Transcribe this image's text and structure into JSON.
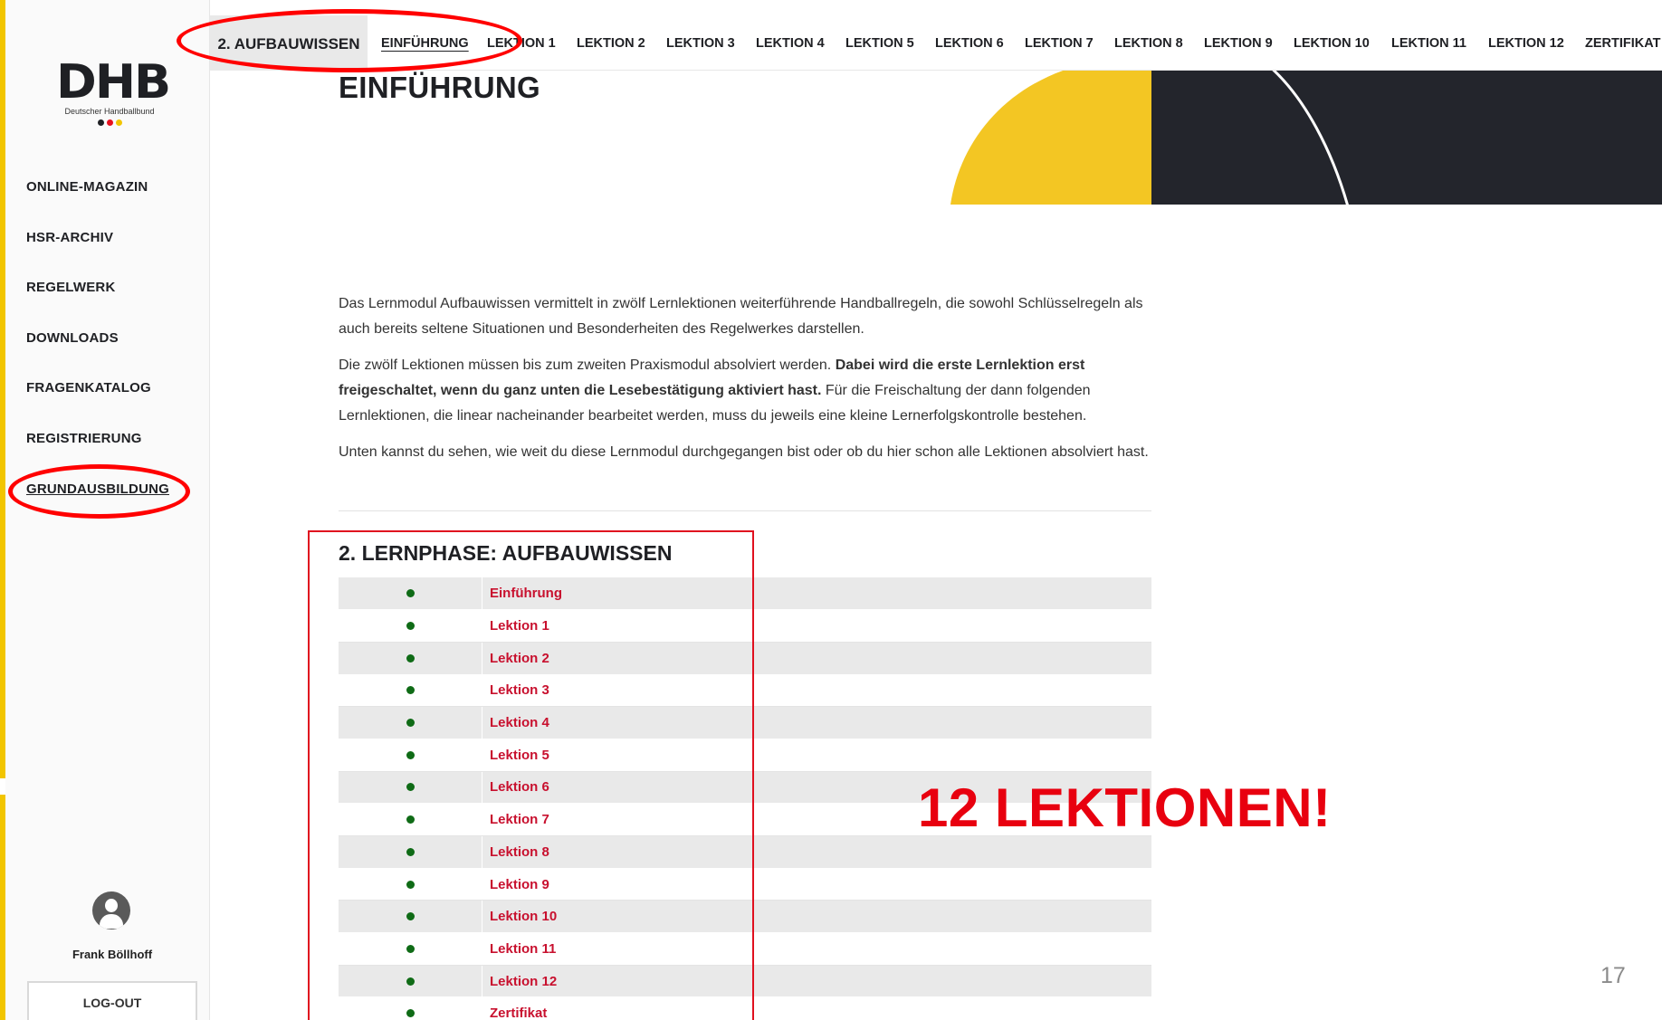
{
  "logo": {
    "mark": "DHB",
    "subtitle": "Deutscher Handballbund",
    "dot_colors": [
      "#1f2024",
      "#e8101f",
      "#f2c500"
    ]
  },
  "sidebar": {
    "items": [
      {
        "label": "ONLINE-MAGAZIN"
      },
      {
        "label": "HSR-ARCHIV"
      },
      {
        "label": "REGELWERK"
      },
      {
        "label": "DOWNLOADS"
      },
      {
        "label": "FRAGENKATALOG"
      },
      {
        "label": "REGISTRIERUNG"
      },
      {
        "label": "GRUNDAUSBILDUNG",
        "active": true
      }
    ],
    "user_name": "Frank Böllhoff",
    "logout_label": "LOG-OUT"
  },
  "topnav": {
    "section": "2. AUFBAUWISSEN",
    "items": [
      {
        "label": "EINFÜHRUNG",
        "current": true
      },
      {
        "label": "LEKTION 1"
      },
      {
        "label": "LEKTION 2"
      },
      {
        "label": "LEKTION 3"
      },
      {
        "label": "LEKTION 4"
      },
      {
        "label": "LEKTION 5"
      },
      {
        "label": "LEKTION 6"
      },
      {
        "label": "LEKTION 7"
      },
      {
        "label": "LEKTION 8"
      },
      {
        "label": "LEKTION 9"
      },
      {
        "label": "LEKTION 10"
      },
      {
        "label": "LEKTION 11"
      },
      {
        "label": "LEKTION 12"
      },
      {
        "label": "ZERTIFIKAT"
      }
    ]
  },
  "page": {
    "title": "EINFÜHRUNG",
    "para1": "Das Lernmodul Aufbauwissen vermittelt in zwölf Lernlektionen weiterführende Handballregeln, die sowohl Schlüsselregeln als auch bereits seltene Situationen und Besonderheiten des Regelwerkes darstellen.",
    "para2_start": "Die zwölf Lektionen müssen bis zum zweiten Praxismodul absolviert werden. ",
    "para2_bold": "Dabei wird die erste Lernlektion erst freigeschaltet, wenn du ganz unten die Lesebestätigung aktiviert hast.",
    "para2_end": " Für die Freischaltung der dann folgenden Lernlektionen, die linear nacheinander bearbeitet werden, muss du jeweils eine kleine Lernerfolgskontrolle bestehen.",
    "para3": "Unten kannst du sehen, wie weit du diese Lernmodul durchgegangen bist oder ob du hier schon alle Lektionen absolviert hast."
  },
  "progress": {
    "title": "2. LERNPHASE: AUFBAUWISSEN",
    "status_color": "#0f6b16",
    "rows": [
      {
        "label": "Einführung"
      },
      {
        "label": "Lektion 1"
      },
      {
        "label": "Lektion 2"
      },
      {
        "label": "Lektion 3"
      },
      {
        "label": "Lektion 4"
      },
      {
        "label": "Lektion 5"
      },
      {
        "label": "Lektion 6"
      },
      {
        "label": "Lektion 7"
      },
      {
        "label": "Lektion 8"
      },
      {
        "label": "Lektion 9"
      },
      {
        "label": "Lektion 10"
      },
      {
        "label": "Lektion 11"
      },
      {
        "label": "Lektion 12"
      },
      {
        "label": "Zertifikat"
      }
    ]
  },
  "annotation": {
    "text": "12 LEKTIONEN!",
    "color": "#e8000f"
  },
  "slide_number": "17"
}
